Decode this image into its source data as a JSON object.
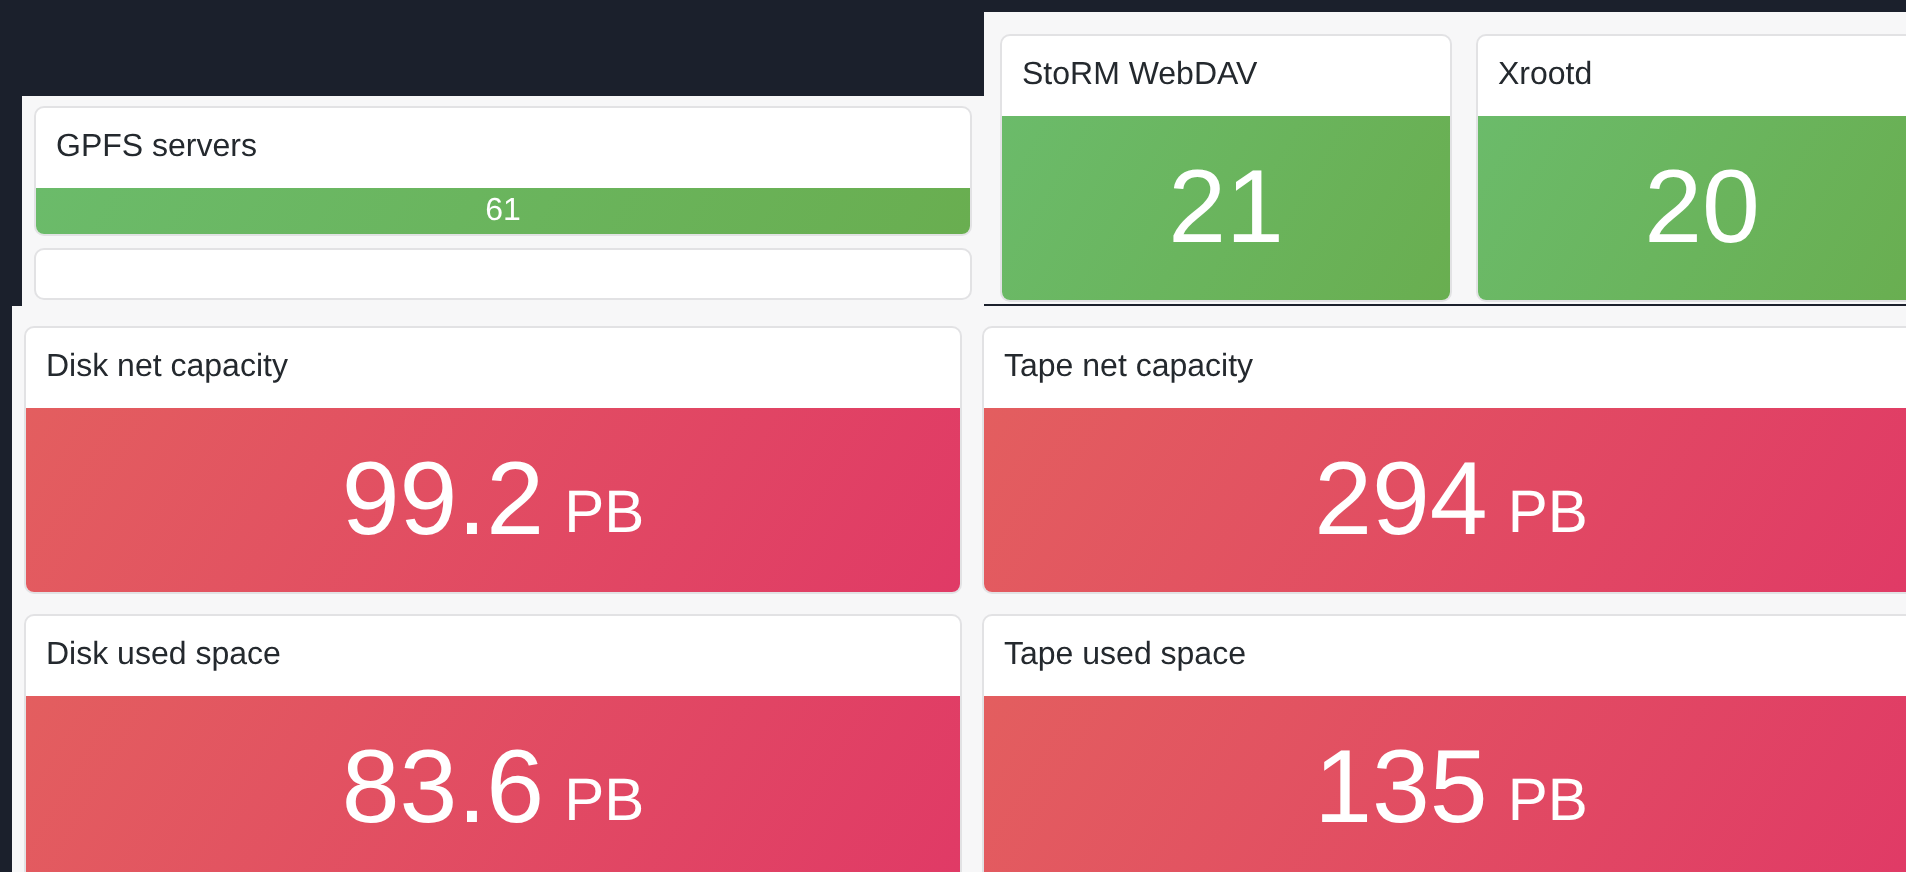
{
  "clips": [
    {
      "panels": [
        {
          "title": "GPFS servers",
          "value": "61",
          "kind": "ok"
        }
      ]
    },
    {
      "panels": [
        {
          "title": "StoRM WebDAV",
          "value": "21",
          "kind": "ok"
        },
        {
          "title": "Xrootd",
          "value": "20",
          "kind": "ok"
        }
      ]
    },
    {
      "panels": [
        {
          "title": "Disk net capacity",
          "value": "99.2",
          "unit": "PB",
          "kind": "alert"
        },
        {
          "title": "Tape net capacity",
          "value": "294",
          "unit": "PB",
          "kind": "alert"
        },
        {
          "title": "Disk used space",
          "value": "83.6",
          "unit": "PB",
          "kind": "alert"
        },
        {
          "title": "Tape used space",
          "value": "135",
          "unit": "PB",
          "kind": "alert"
        }
      ]
    }
  ]
}
